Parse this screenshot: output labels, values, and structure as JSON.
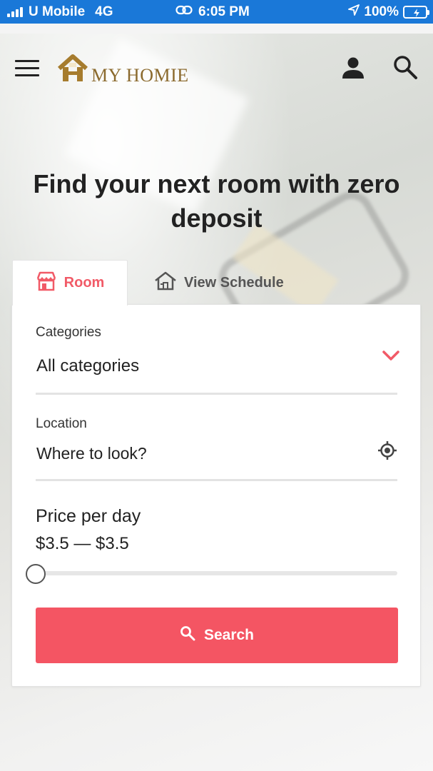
{
  "status_bar": {
    "carrier": "U Mobile",
    "network": "4G",
    "time": "6:05 PM",
    "battery": "100%",
    "color": "#1a78d8"
  },
  "header": {
    "logo_text": "MY HOMIE",
    "icons": [
      "menu-icon",
      "logo-house-icon",
      "user-icon",
      "search-icon"
    ]
  },
  "hero": {
    "headline": "Find your next room with zero deposit"
  },
  "tabs": [
    {
      "label": "Room",
      "icon": "store-icon",
      "active": true
    },
    {
      "label": "View Schedule",
      "icon": "house-icon",
      "active": false
    }
  ],
  "form": {
    "categories": {
      "label": "Categories",
      "value": "All categories"
    },
    "location": {
      "label": "Location",
      "value": "Where to look?"
    },
    "price": {
      "label": "Price per day",
      "range": "$3.5 — $3.5",
      "slider_value_fraction": 0
    },
    "search_label": "Search"
  },
  "colors": {
    "accent": "#f45563",
    "logo": "#8b6a2e"
  }
}
